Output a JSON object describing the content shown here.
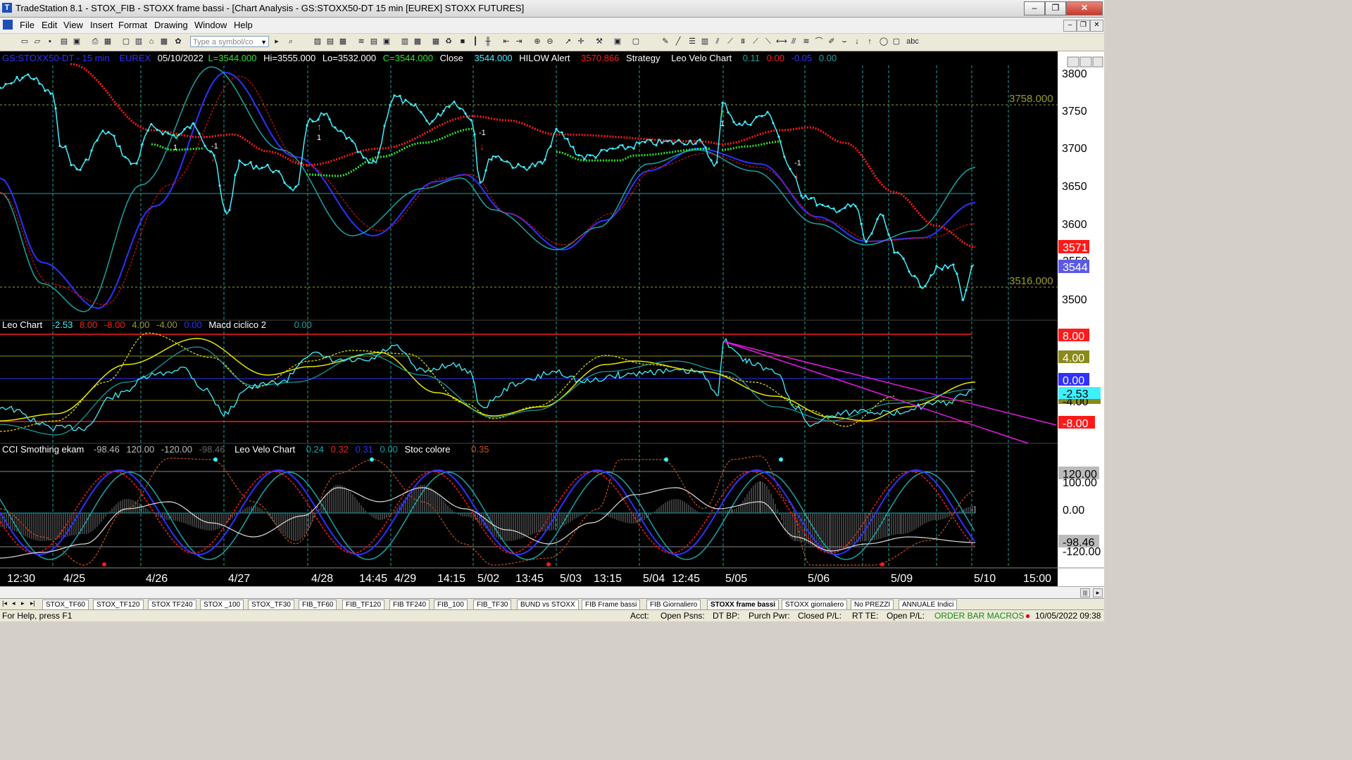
{
  "window": {
    "title": "TradeStation 8.1 - STOX_FIB - STOXX frame bassi - [Chart Analysis - GS:STOXX50-DT  15 min  [EUREX] STOXX FUTURES]",
    "min": "–",
    "max": "❐",
    "close": "✕"
  },
  "menu": [
    "File",
    "Edit",
    "View",
    "Insert",
    "Format",
    "Drawing",
    "Window",
    "Help"
  ],
  "toolbar": {
    "symbol_placeholder": "Type a symbol/co"
  },
  "header": {
    "symbol": "GS:STOXX50-DT - 15 min",
    "exchange": "EUREX",
    "date": "05/10/2022",
    "last": "L=3544.000",
    "hi": "Hi=3555.000",
    "lo": "Lo=3532.000",
    "close_eq": "C=3544.000",
    "close_label": "Close",
    "close_val": "3544.000",
    "hilow": "HILOW Alert",
    "hilow_val": "3570.866",
    "strategy": "Strategy",
    "velo": "Leo Velo Chart",
    "v1": "0.11",
    "v2": "0.00",
    "v3": "-0.05",
    "v4": "0.00"
  },
  "price_axis": {
    "ticks": [
      "3800",
      "3750",
      "3700",
      "3650",
      "3600",
      "3500"
    ],
    "h1": "3758.000",
    "h2": "3516.000",
    "tag_red": "3571",
    "tag_blue": "3544",
    "tag_hidden": "3550"
  },
  "leo": {
    "name": "Leo Chart",
    "v1": "-2.53",
    "v2": "8.00",
    "v3": "-8.00",
    "v4": "4.00",
    "v5": "-4.00",
    "v6": "0.00",
    "macd": "Macd ciclico 2",
    "macd_val": "0.00",
    "axis": [
      "8.00",
      "4.00",
      "0.00",
      "-2.53",
      "-4.00",
      "-8.00"
    ]
  },
  "cci": {
    "name": "CCI Smothing ekam",
    "v1": "-98.46",
    "v2": "120.00",
    "v3": "-120.00",
    "v4": "-98.46",
    "velo": "Leo Velo Chart",
    "w1": "0.24",
    "w2": "0.32",
    "w3": "0.31",
    "w4": "0.00",
    "stoc": "Stoc colore",
    "stoc_val": "0.35",
    "axis": [
      "120.00",
      "100.00",
      "0.00",
      "-98.46",
      "-120.00"
    ]
  },
  "signals": [
    "1",
    "-1",
    "1",
    "-1",
    "1",
    "-1"
  ],
  "time_axis": [
    "12:30",
    "4/25",
    "4/26",
    "4/27",
    "4/28",
    "14:45",
    "4/29",
    "14:15",
    "5/02",
    "13:45",
    "5/03",
    "13:15",
    "5/04",
    "12:45",
    "5/05",
    "5/06",
    "5/09",
    "5/10",
    "15:00"
  ],
  "tabs": [
    "STOX_TF60",
    "STOX_TF120",
    "STOX TF240",
    "STOX _100",
    "STOX_TF30",
    "FIB_TF60",
    "FIB_TF120",
    "FIB TF240",
    "FIB_100",
    "FIB_TF30",
    "BUND vs STOXX",
    "FIB Frame bassi",
    "FIB Giornaliero",
    "STOXX frame bassi",
    "STOXX giornaliero",
    "No PREZZI",
    "ANNUALE Indici"
  ],
  "status": {
    "help": "For Help, press F1",
    "acct": "Acct:",
    "open_psns": "Open Psns:",
    "dtbp": "DT BP:",
    "purch": "Purch Pwr:",
    "closed": "Closed P/L:",
    "rtte": "RT TE:",
    "openpl": "Open P/L:",
    "macros": "ORDER BAR  MACROS",
    "datetime": "10/05/2022 09:38"
  },
  "colors": {
    "bg": "#000000",
    "cyan": "#3ff0ff",
    "green": "#26e626",
    "red": "#ff1a1a",
    "blue": "#3030ff",
    "teal": "#1aa3a3",
    "yellow": "#e6e600",
    "magenta": "#e619e6",
    "olive": "#9b9b2a"
  }
}
